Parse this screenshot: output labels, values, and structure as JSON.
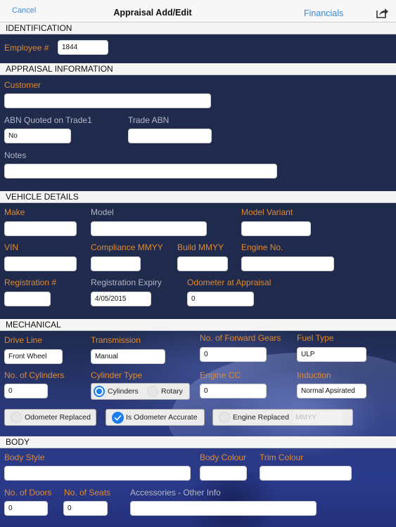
{
  "navbar": {
    "cancel_label": "Cancel",
    "title": "Appraisal Add/Edit",
    "financials_label": "Financials",
    "share_icon": "share-icon"
  },
  "sections": {
    "identification": "IDENTIFICATION",
    "appraisal_information": "APPRAISAL INFORMATION",
    "vehicle_details": "VEHICLE DETAILS",
    "mechanical": "MECHANICAL",
    "body": "BODY"
  },
  "identification": {
    "employee_label": "Employee #",
    "employee_value": "1844"
  },
  "appraisal": {
    "customer_label": "Customer",
    "customer_value": "",
    "abn_quoted_label": "ABN Quoted on Trade1",
    "abn_quoted_value": "No",
    "trade_abn_label": "Trade ABN",
    "trade_abn_value": "",
    "notes_label": "Notes",
    "notes_value": ""
  },
  "vehicle": {
    "make_label": "Make",
    "make_value": "",
    "model_label": "Model",
    "model_value": "",
    "model_variant_label": "Model Variant",
    "model_variant_value": "",
    "vin_label": "VIN",
    "vin_value": "",
    "compliance_label": "Compliance MMYY",
    "compliance_value": "",
    "build_label": "Build MMYY",
    "build_value": "",
    "engine_no_label": "Engine No.",
    "engine_no_value": "",
    "registration_label": "Registration #",
    "registration_value": "",
    "registration_expiry_label": "Registration Expiry",
    "registration_expiry_value": "4/05/2015",
    "odometer_label": "Odometer at Appraisal",
    "odometer_value": "0"
  },
  "mechanical": {
    "drive_line_label": "Drive Line",
    "drive_line_value": "Front Wheel",
    "transmission_label": "Transmission",
    "transmission_value": "Manual",
    "forward_gears_label": "No. of Forward Gears",
    "forward_gears_value": "0",
    "fuel_type_label": "Fuel Type",
    "fuel_type_value": "ULP",
    "cylinders_count_label": "No. of Cylinders",
    "cylinders_count_value": "0",
    "cylinder_type_label": "Cylinder Type",
    "cylinder_type_options": [
      "Cylinders",
      "Rotary"
    ],
    "cylinder_type_selected": "Cylinders",
    "engine_cc_label": "Engine CC",
    "engine_cc_value": "0",
    "induction_label": "Induction",
    "induction_value": "Normal Apsirated",
    "odometer_replaced_label": "Odometer Replaced",
    "odometer_replaced_checked": false,
    "odometer_accurate_label": "Is Odometer Accurate",
    "odometer_accurate_checked": true,
    "engine_replaced_label": "Engine Replaced",
    "engine_replaced_checked": false,
    "engine_replaced_placeholder": "MMYY"
  },
  "body": {
    "body_style_label": "Body Style",
    "body_style_value": "",
    "body_colour_label": "Body Colour",
    "body_colour_value": "",
    "trim_colour_label": "Trim Colour",
    "trim_colour_value": "",
    "doors_label": "No. of Doors",
    "doors_value": "0",
    "seats_label": "No. of Seats",
    "seats_value": "0",
    "accessories_label": "Accessories - Other Info",
    "accessories_value": ""
  },
  "colors": {
    "accent_blue": "#3b8ad9",
    "label_orange": "#e08a2e",
    "label_grey": "#b4b8c6",
    "background_navy": "#1f2a4c",
    "check_blue": "#1a7ef0"
  }
}
